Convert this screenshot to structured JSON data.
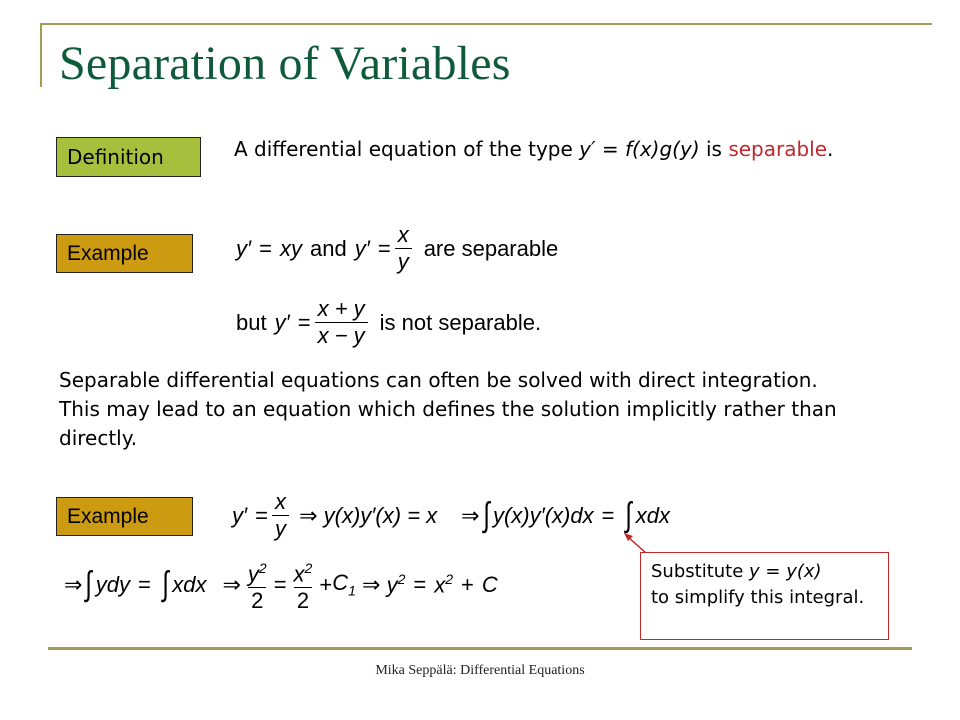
{
  "slide": {
    "title": "Separation of Variables",
    "accent_color": "#a39c54",
    "title_color": "#0f5a3a"
  },
  "definition": {
    "tag": "Definition",
    "text_before": "A differential equation of the type ",
    "formula": "y′ = f(x)g(y)",
    "text_after": " is ",
    "highlight": "separable",
    "end": "."
  },
  "example1": {
    "tag": "Example",
    "line1": {
      "eq1_lhs": "y′",
      "eq1_rhs": "xy",
      "connector": "and",
      "eq2_lhs": "y′",
      "eq2_num": "x",
      "eq2_den": "y",
      "tail": "are separable"
    },
    "line2": {
      "prefix": "but",
      "lhs": "y′",
      "num": "x + y",
      "den": "x − y",
      "tail": "is not separable."
    }
  },
  "paragraph": "Separable differential equations can often be solved with direct integration.  This may lead to an equation which defines the solution implicitly rather than directly.",
  "example2": {
    "tag": "Example",
    "line1": {
      "lhs": "y′",
      "num": "x",
      "den": "y",
      "step1": "y(x)y′(x) = x",
      "step2_left": "y(x)y′(x)dx",
      "step2_right": "xdx"
    },
    "line2": {
      "int_left": "ydy",
      "int_right": "xdx",
      "frac1_num": "y",
      "frac1_den": "2",
      "frac2_num": "x",
      "frac2_den": "2",
      "const1": "C",
      "const1_sub": "1",
      "final_lhs": "y",
      "final_rhs_var": "x",
      "final_const": "C",
      "exponent": "2"
    },
    "note": {
      "line1_text": "Substitute ",
      "line1_formula": "y = y(x)",
      "rest": "to simplify this integral."
    }
  },
  "footer": "Mika Seppälä: Differential Equations"
}
